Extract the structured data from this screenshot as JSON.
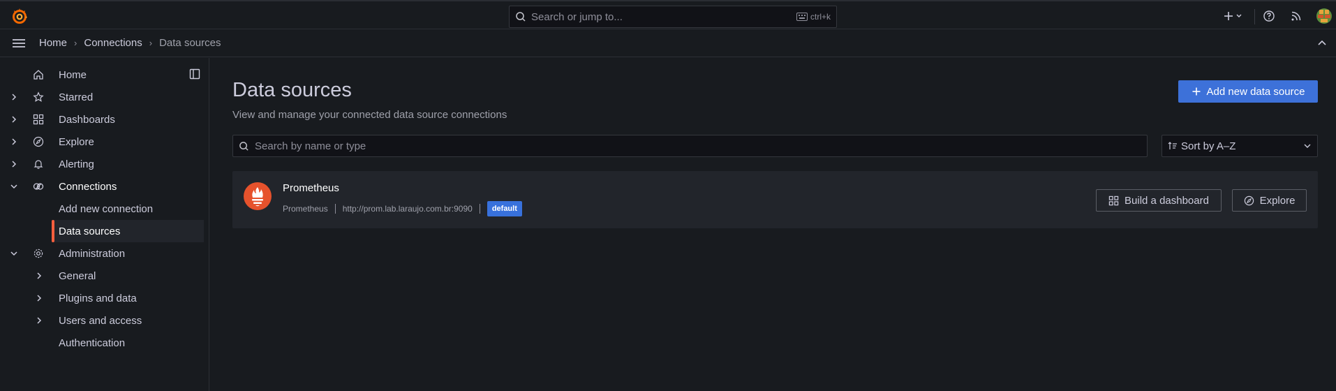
{
  "topbar": {
    "search_placeholder": "Search or jump to...",
    "search_shortcut": "ctrl+k",
    "plus_icon": "plus-icon",
    "help_icon": "help-circle-icon",
    "news_icon": "rss-icon"
  },
  "breadcrumb": {
    "items": [
      "Home",
      "Connections",
      "Data sources"
    ]
  },
  "sidebar": {
    "items": [
      {
        "label": "Home",
        "icon": "home-icon",
        "expandable": false
      },
      {
        "label": "Starred",
        "icon": "star-icon",
        "expandable": true
      },
      {
        "label": "Dashboards",
        "icon": "apps-icon",
        "expandable": true
      },
      {
        "label": "Explore",
        "icon": "compass-icon",
        "expandable": true
      },
      {
        "label": "Alerting",
        "icon": "bell-icon",
        "expandable": true
      },
      {
        "label": "Connections",
        "icon": "connections-icon",
        "expanded": true
      },
      {
        "label": "Add new connection"
      },
      {
        "label": "Data sources",
        "active": true
      },
      {
        "label": "Administration",
        "icon": "gear-icon",
        "expanded": true
      },
      {
        "label": "General",
        "expandable": true
      },
      {
        "label": "Plugins and data",
        "expandable": true
      },
      {
        "label": "Users and access",
        "expandable": true
      },
      {
        "label": "Authentication"
      }
    ]
  },
  "main": {
    "title": "Data sources",
    "subtitle": "View and manage your connected data source connections",
    "add_button": "Add new data source",
    "filter_placeholder": "Search by name or type",
    "sort_label": "Sort by A–Z"
  },
  "datasources": [
    {
      "name": "Prometheus",
      "type": "Prometheus",
      "url": "http://prom.lab.laraujo.com.br:9090",
      "badge": "default",
      "build_button": "Build a dashboard",
      "explore_button": "Explore"
    }
  ],
  "colors": {
    "background": "#181b1f",
    "accent_primary": "#3d71d9",
    "active_indicator": "#f55f3e",
    "card_background": "#22252b"
  }
}
